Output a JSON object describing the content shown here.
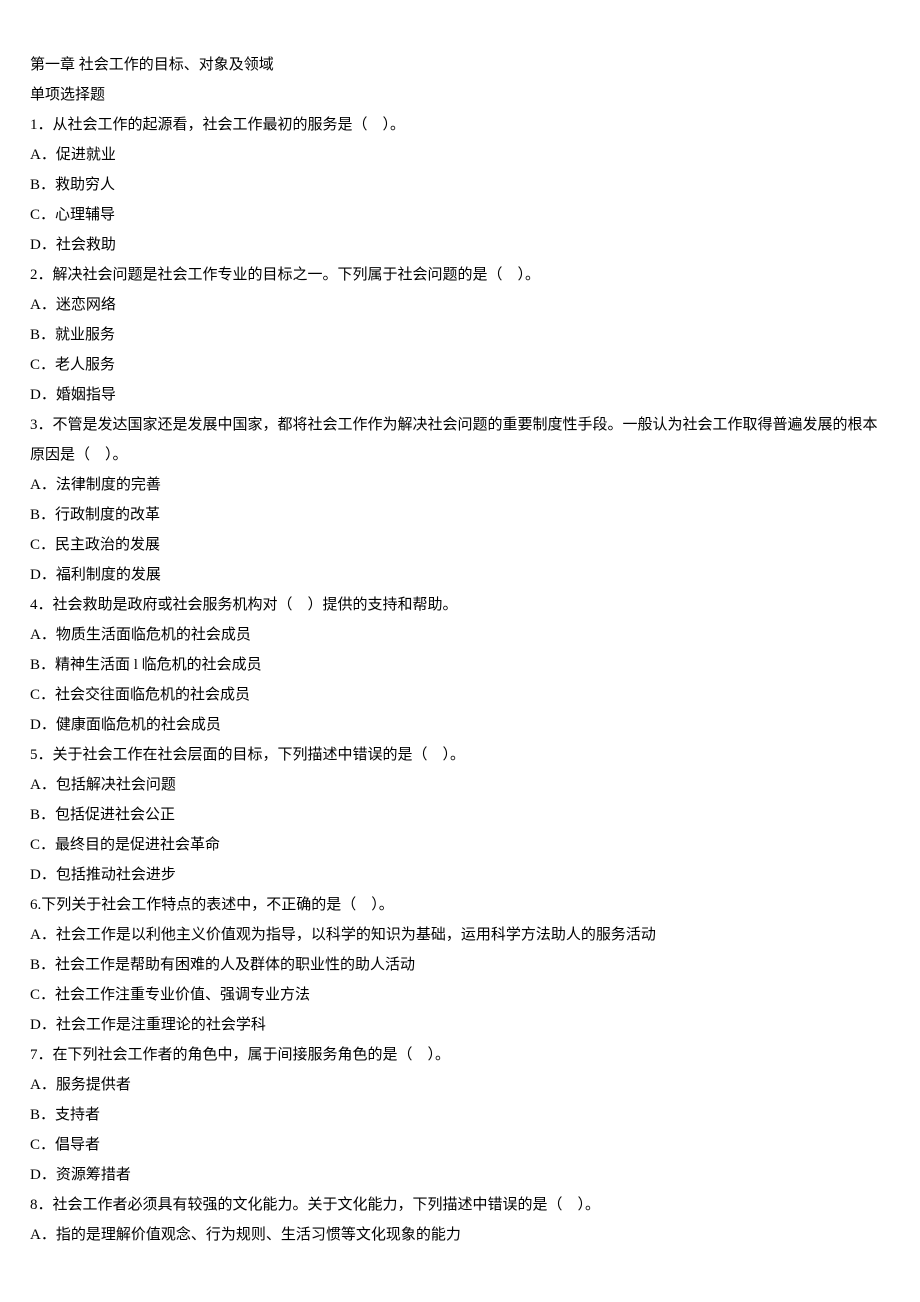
{
  "chapter_title": "第一章 社会工作的目标、对象及领域",
  "section_title": "单项选择题",
  "questions": [
    {
      "stem_lines": [
        "1．从社会工作的起源看，社会工作最初的服务是（　）。"
      ],
      "options": [
        "A．促进就业",
        "B．救助穷人",
        "C．心理辅导",
        "D．社会救助"
      ]
    },
    {
      "stem_lines": [
        "2．解决社会问题是社会工作专业的目标之一。下列属于社会问题的是（　）。"
      ],
      "options": [
        "A．迷恋网络",
        "B．就业服务",
        "C．老人服务",
        "D．婚姻指导"
      ]
    },
    {
      "stem_lines": [
        "3．不管是发达国家还是发展中国家，都将社会工作作为解决社会问题的重要制度性手段。一般认为社会工作取得普遍发展的根本原因是（　）。"
      ],
      "options": [
        "A．法律制度的完善",
        "B．行政制度的改革",
        "C．民主政治的发展",
        "D．福利制度的发展"
      ]
    },
    {
      "stem_lines": [
        "4．社会救助是政府或社会服务机构对（　）提供的支持和帮助。"
      ],
      "options": [
        "A．物质生活面临危机的社会成员",
        "B．精神生活面 l 临危机的社会成员",
        "C．社会交往面临危机的社会成员",
        "D．健康面临危机的社会成员"
      ]
    },
    {
      "stem_lines": [
        "5．关于社会工作在社会层面的目标，下列描述中错误的是（　）。"
      ],
      "options": [
        "A．包括解决社会问题",
        "B．包括促进社会公正",
        "C．最终目的是促进社会革命",
        "D．包括推动社会进步"
      ]
    },
    {
      "stem_lines": [
        "6.下列关于社会工作特点的表述中，不正确的是（　）。"
      ],
      "options": [
        "A．社会工作是以利他主义价值观为指导，以科学的知识为基础，运用科学方法助人的服务活动",
        "B．社会工作是帮助有困难的人及群体的职业性的助人活动",
        "C．社会工作注重专业价值、强调专业方法",
        "D．社会工作是注重理论的社会学科"
      ]
    },
    {
      "stem_lines": [
        "7．在下列社会工作者的角色中，属于间接服务角色的是（　）。"
      ],
      "options": [
        "A．服务提供者",
        "B．支持者",
        "C．倡导者",
        "D．资源筹措者"
      ]
    },
    {
      "stem_lines": [
        "8．社会工作者必须具有较强的文化能力。关于文化能力，下列描述中错误的是（　）。"
      ],
      "options": [
        "A．指的是理解价值观念、行为规则、生活习惯等文化现象的能力"
      ]
    }
  ]
}
